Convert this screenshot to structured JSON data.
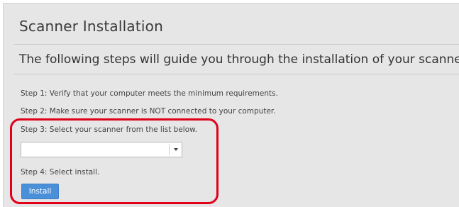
{
  "page": {
    "title": "Scanner Installation",
    "subtitle": "The following steps will guide you through the installation of your scanner."
  },
  "steps": [
    "Step 1: Verify that your computer meets the minimum requirements.",
    "Step 2: Make sure your scanner is NOT connected to your computer.",
    "Step 3: Select your scanner from the list below.",
    "Step 4: Select install."
  ],
  "scanner_select": {
    "selected_value": "",
    "icon": "chevron-down-icon"
  },
  "install_button": {
    "label": "Install"
  },
  "colors": {
    "panel_background": "#e6e6e6",
    "button_blue": "#4a90d9",
    "highlight_red": "#e0001a"
  }
}
